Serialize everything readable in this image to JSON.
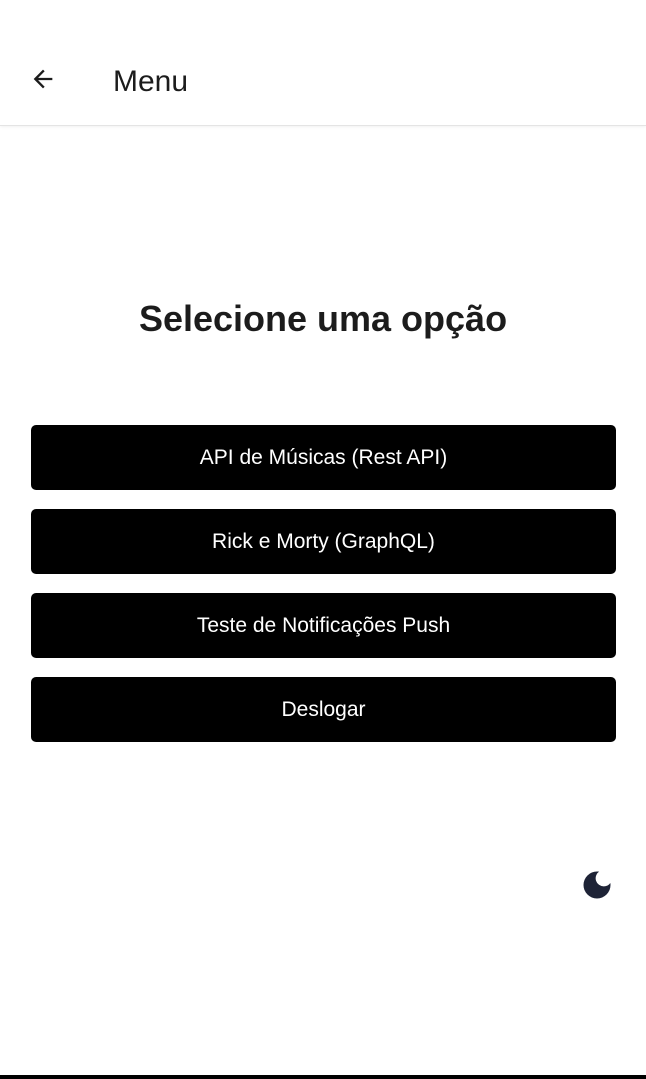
{
  "app_bar": {
    "title": "Menu",
    "back_icon": "arrow-left-icon"
  },
  "main": {
    "heading": "Selecione uma opção",
    "options": [
      {
        "label": "API de Músicas (Rest API)"
      },
      {
        "label": "Rick e Morty (GraphQL)"
      },
      {
        "label": "Teste de Notificações Push"
      },
      {
        "label": "Deslogar"
      }
    ]
  },
  "theme_toggle": {
    "icon": "moon-icon",
    "color": "#1e2336"
  },
  "colors": {
    "button_background": "#000000",
    "button_text": "#ffffff",
    "text": "#1c1c1c",
    "background": "#ffffff"
  }
}
